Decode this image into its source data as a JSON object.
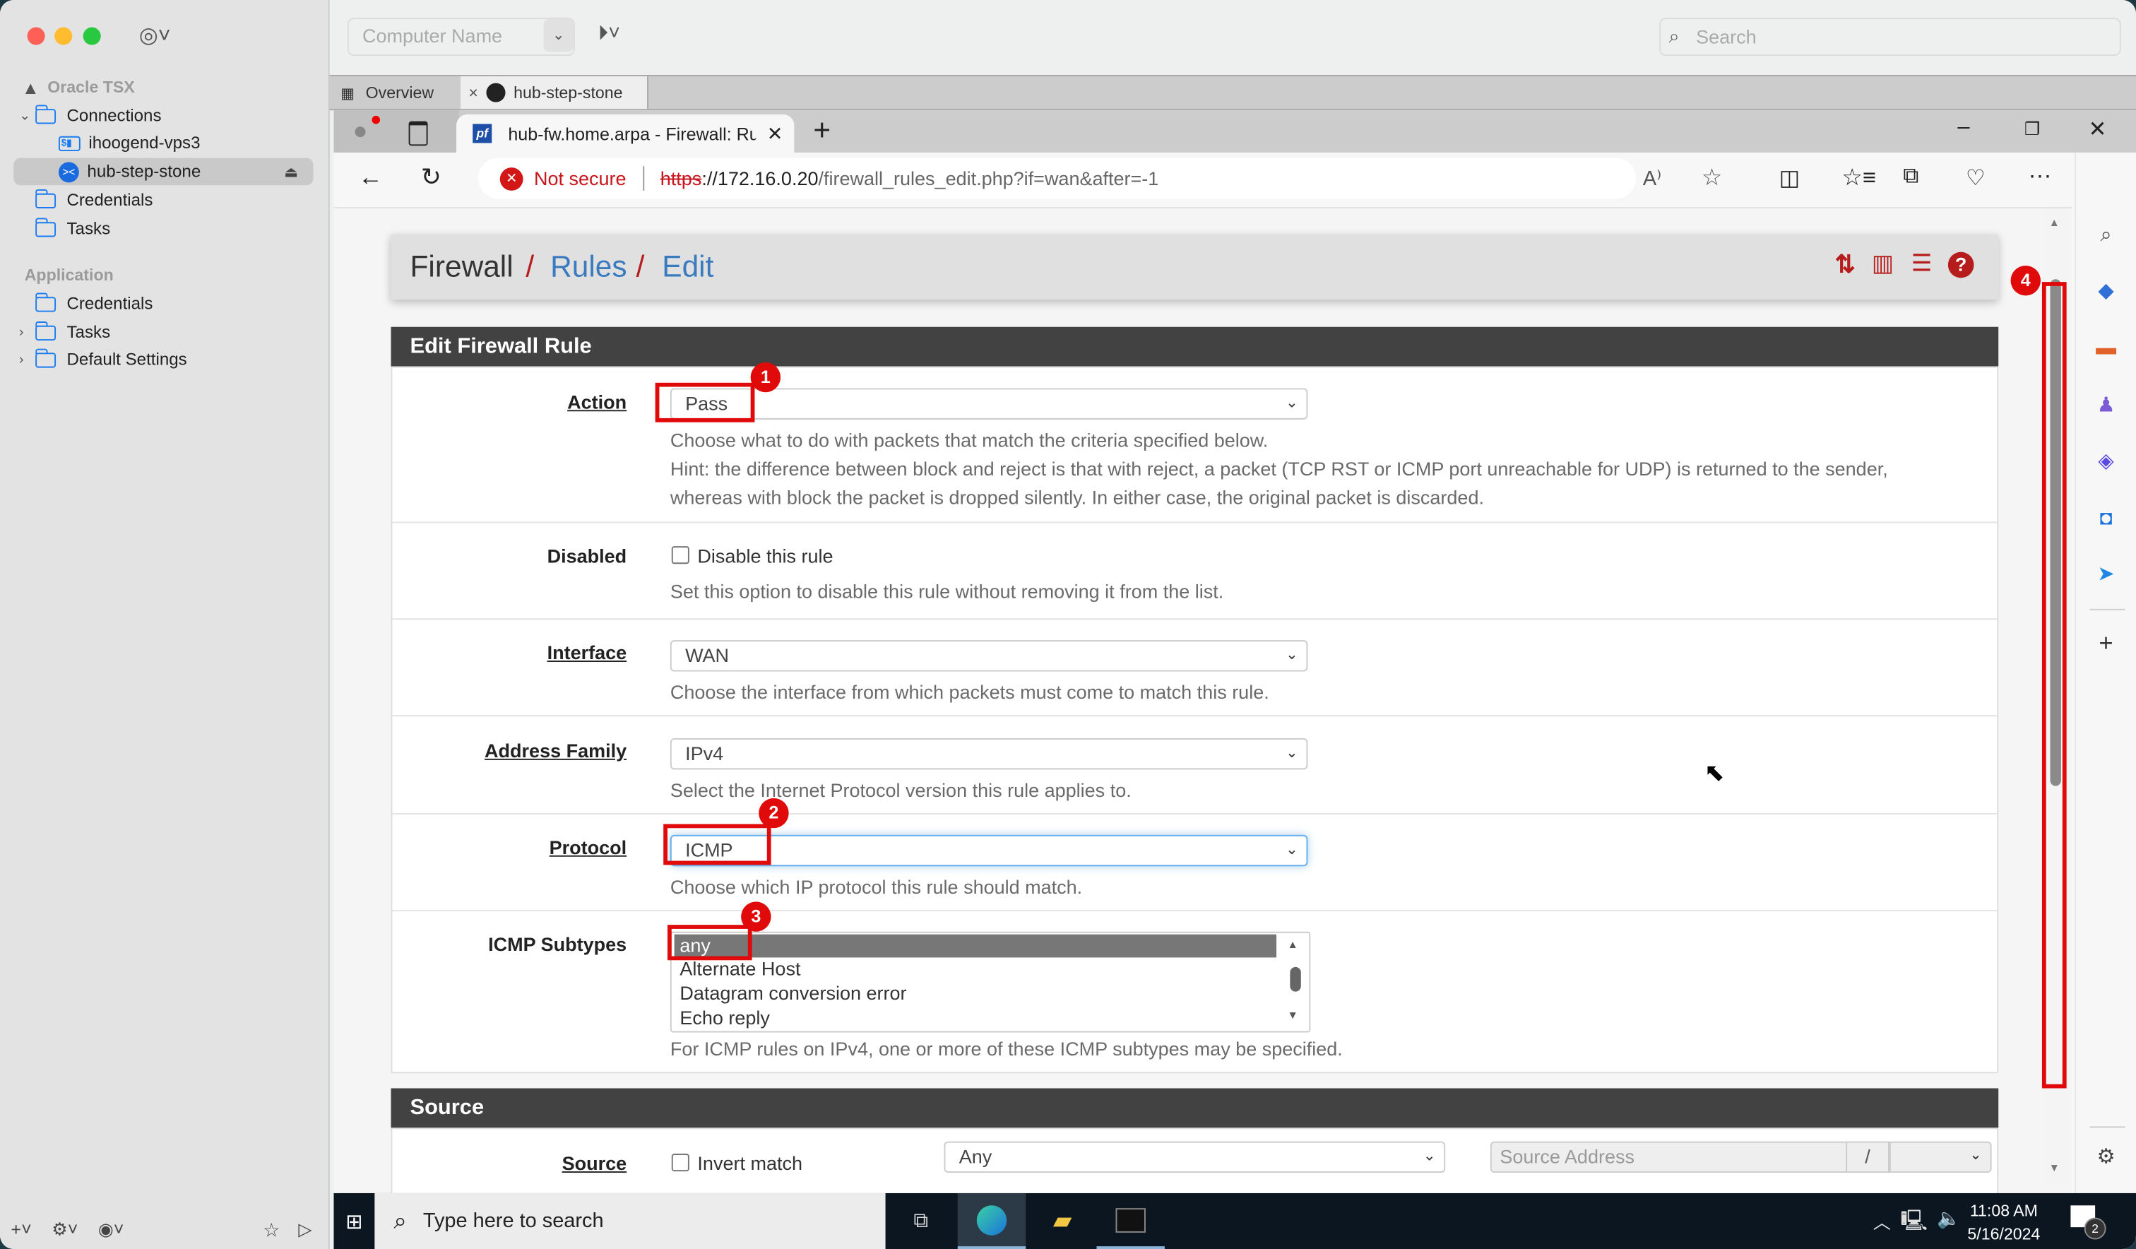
{
  "mac": {
    "sidebar": {
      "workspace": "Oracle TSX",
      "connections_folder": "Connections",
      "connections": [
        {
          "label": "ihoogend-vps3",
          "type": "ssh"
        },
        {
          "label": "hub-step-stone",
          "type": "rdp",
          "selected": true
        }
      ],
      "workspace_folders": [
        "Credentials",
        "Tasks"
      ],
      "application_section": "Application",
      "application_folders": [
        "Credentials",
        "Tasks",
        "Default Settings"
      ]
    },
    "toolbar": {
      "computer_name_placeholder": "Computer Name",
      "search_placeholder": "Search"
    },
    "tabs": [
      {
        "label": "Overview"
      },
      {
        "label": "hub-step-stone",
        "active": true
      }
    ]
  },
  "browser": {
    "tab_title": "hub-fw.home.arpa - Firewall: Rul",
    "security_label": "Not secure",
    "url_scheme": "https",
    "url_host": "://172.16.0.20",
    "url_path": "/firewall_rules_edit.php?if=wan&after=-1"
  },
  "pfsense": {
    "breadcrumb": [
      "Firewall",
      "Rules",
      "Edit"
    ],
    "breadcrumb_sep": "/",
    "panel_title": "Edit Firewall Rule",
    "fields": {
      "action": {
        "label": "Action",
        "value": "Pass",
        "help1": "Choose what to do with packets that match the criteria specified below.",
        "help2": "Hint: the difference between block and reject is that with reject, a packet (TCP RST or ICMP port unreachable for UDP) is returned to the sender,",
        "help3": "whereas with block the packet is dropped silently. In either case, the original packet is discarded."
      },
      "disabled": {
        "label": "Disabled",
        "checkbox_label": "Disable this rule",
        "checked": false,
        "help": "Set this option to disable this rule without removing it from the list."
      },
      "interface": {
        "label": "Interface",
        "value": "WAN",
        "help": "Choose the interface from which packets must come to match this rule."
      },
      "address_family": {
        "label": "Address Family",
        "value": "IPv4",
        "help": "Select the Internet Protocol version this rule applies to."
      },
      "protocol": {
        "label": "Protocol",
        "value": "ICMP",
        "help": "Choose which IP protocol this rule should match."
      },
      "icmp_subtypes": {
        "label": "ICMP Subtypes",
        "options": [
          "any",
          "Alternate Host",
          "Datagram conversion error",
          "Echo reply"
        ],
        "selected": "any",
        "help": "For ICMP rules on IPv4, one or more of these ICMP subtypes may be specified."
      }
    },
    "source_panel_title": "Source",
    "source": {
      "label": "Source",
      "invert_label": "Invert match",
      "invert_checked": false,
      "type_value": "Any",
      "address_placeholder": "Source Address",
      "mask_sep": "/"
    }
  },
  "annotations": [
    "1",
    "2",
    "3",
    "4"
  ],
  "taskbar": {
    "search_placeholder": "Type here to search",
    "time": "11:08 AM",
    "date": "5/16/2024",
    "notification_count": "2"
  }
}
